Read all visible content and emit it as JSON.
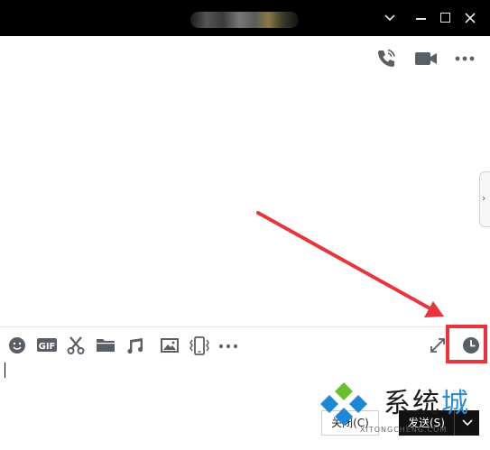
{
  "window": {
    "title_blurred": true
  },
  "header": {
    "icons": [
      "phone-icon",
      "video-camera-icon",
      "more-icon"
    ]
  },
  "toolbar": {
    "items": [
      "emoji-icon",
      "gif-icon",
      "screenshot-scissors-icon",
      "folder-icon",
      "music-icon",
      "image-icon",
      "shake-window-icon",
      "more-icon"
    ],
    "gif_label": "GIF",
    "right_items": [
      "expand-icon",
      "history-clock-icon"
    ]
  },
  "side_tab": {
    "chevron": "›"
  },
  "buttons": {
    "close_label": "关闭(C)",
    "send_label": "发送(S)"
  },
  "watermark": {
    "text_a": "系统",
    "text_b": "城",
    "subtext": "XITONGCHENG.COM"
  },
  "colors": {
    "titlebar": "#000000",
    "icon_gray": "#5a5f66",
    "highlight_red": "#e8353b",
    "send_button": "#111111"
  }
}
